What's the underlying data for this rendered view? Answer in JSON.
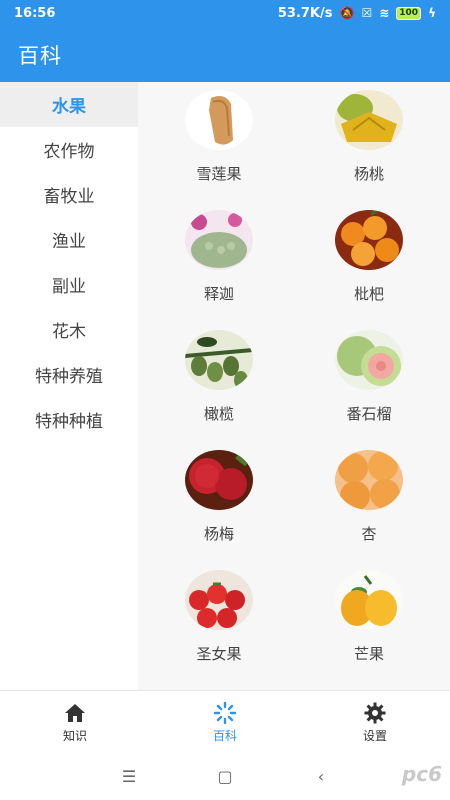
{
  "status": {
    "time": "16:56",
    "speed": "53.7K/s",
    "battery": "100"
  },
  "header": {
    "title": "百科"
  },
  "sidebar": {
    "items": [
      {
        "label": "水果",
        "active": true
      },
      {
        "label": "农作物"
      },
      {
        "label": "畜牧业"
      },
      {
        "label": "渔业"
      },
      {
        "label": "副业"
      },
      {
        "label": "花木"
      },
      {
        "label": "特种养殖"
      },
      {
        "label": "特种种植"
      }
    ]
  },
  "fruits": [
    {
      "label": "雪莲果"
    },
    {
      "label": "杨桃"
    },
    {
      "label": "释迦"
    },
    {
      "label": "枇杷"
    },
    {
      "label": "橄榄"
    },
    {
      "label": "番石榴"
    },
    {
      "label": "杨梅"
    },
    {
      "label": "杏"
    },
    {
      "label": "圣女果"
    },
    {
      "label": "芒果"
    }
  ],
  "bottom_nav": {
    "items": [
      {
        "label": "知识",
        "icon": "home-icon"
      },
      {
        "label": "百科",
        "icon": "encyclopedia-icon",
        "active": true
      },
      {
        "label": "设置",
        "icon": "gear-icon"
      }
    ]
  },
  "colors": {
    "accent": "#2e93ea"
  },
  "watermark": "pc6"
}
